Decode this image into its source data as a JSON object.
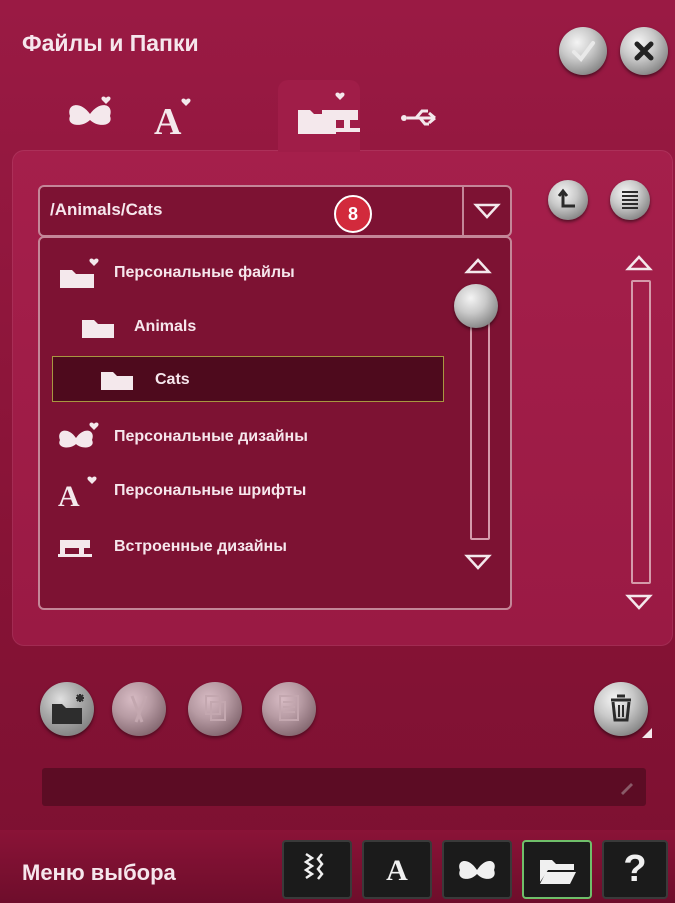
{
  "header": {
    "title": "Файлы и Папки"
  },
  "path": {
    "current": "/Animals/Cats",
    "badge": "8"
  },
  "tree": {
    "items": [
      {
        "label": "Персональные файлы",
        "icon": "folder-heart-icon",
        "level": 0,
        "selected": false
      },
      {
        "label": "Animals",
        "icon": "folder-icon",
        "level": 1,
        "selected": false
      },
      {
        "label": "Cats",
        "icon": "folder-icon",
        "level": 2,
        "selected": true
      },
      {
        "label": "Персональные дизайны",
        "icon": "butterfly-heart-icon",
        "level": 0,
        "selected": false
      },
      {
        "label": "Персональные шрифты",
        "icon": "font-heart-icon",
        "level": 0,
        "selected": false
      },
      {
        "label": "Встроенные дизайны",
        "icon": "sewing-machine-icon",
        "level": 0,
        "selected": false
      }
    ]
  },
  "tabs": [
    "butterfly-heart-icon",
    "font-heart-icon",
    "folder-heart-icon",
    "sewing-machine-icon",
    "usb-icon"
  ],
  "footer": {
    "menu_label": "Меню выбора",
    "buttons": [
      "stitch-icon",
      "font-icon",
      "butterfly-icon",
      "folder-open-icon",
      "help-icon"
    ],
    "help_symbol": "?",
    "font_letter": "A"
  },
  "colors": {
    "background": "#8c1238",
    "accent_badge": "#d22a3c",
    "selected_row": "#4e0a1d"
  }
}
